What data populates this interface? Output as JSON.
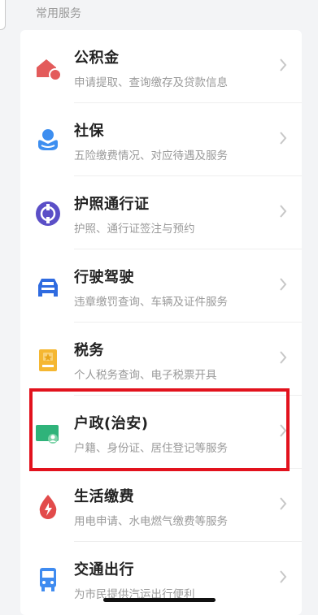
{
  "section": {
    "title": "常用服务"
  },
  "items": [
    {
      "title": "公积金",
      "subtitle": "申请提取、查询缴存及贷款信息",
      "icon": "house-icon"
    },
    {
      "title": "社保",
      "subtitle": "五险缴费情况、对应待遇及服务",
      "icon": "person-hand-icon"
    },
    {
      "title": "护照通行证",
      "subtitle": "护照、通行证签注与预约",
      "icon": "globe-icon"
    },
    {
      "title": "行驶驾驶",
      "subtitle": "违章缴罚查询、车辆及证件服务",
      "icon": "car-icon"
    },
    {
      "title": "税务",
      "subtitle": "个人税务查询、电子税票开具",
      "icon": "tax-badge-icon"
    },
    {
      "title": "户政(治安)",
      "subtitle": "户籍、身份证、居住登记等服务",
      "icon": "id-card-icon"
    },
    {
      "title": "生活缴费",
      "subtitle": "用电申请、水电燃气缴费等服务",
      "icon": "water-drop-icon"
    },
    {
      "title": "交通出行",
      "subtitle": "为市民提供汽运出行便利",
      "icon": "bus-icon"
    }
  ],
  "colors": {
    "highlight": "#e2121d",
    "house": "#e35b5b",
    "social": "#3d8ef0",
    "globe": "#5b4fc7",
    "car": "#2f6be0",
    "tax": "#f5b731",
    "id": "#2fb37a",
    "drop": "#e24b4b",
    "bus": "#3f8bf0"
  }
}
